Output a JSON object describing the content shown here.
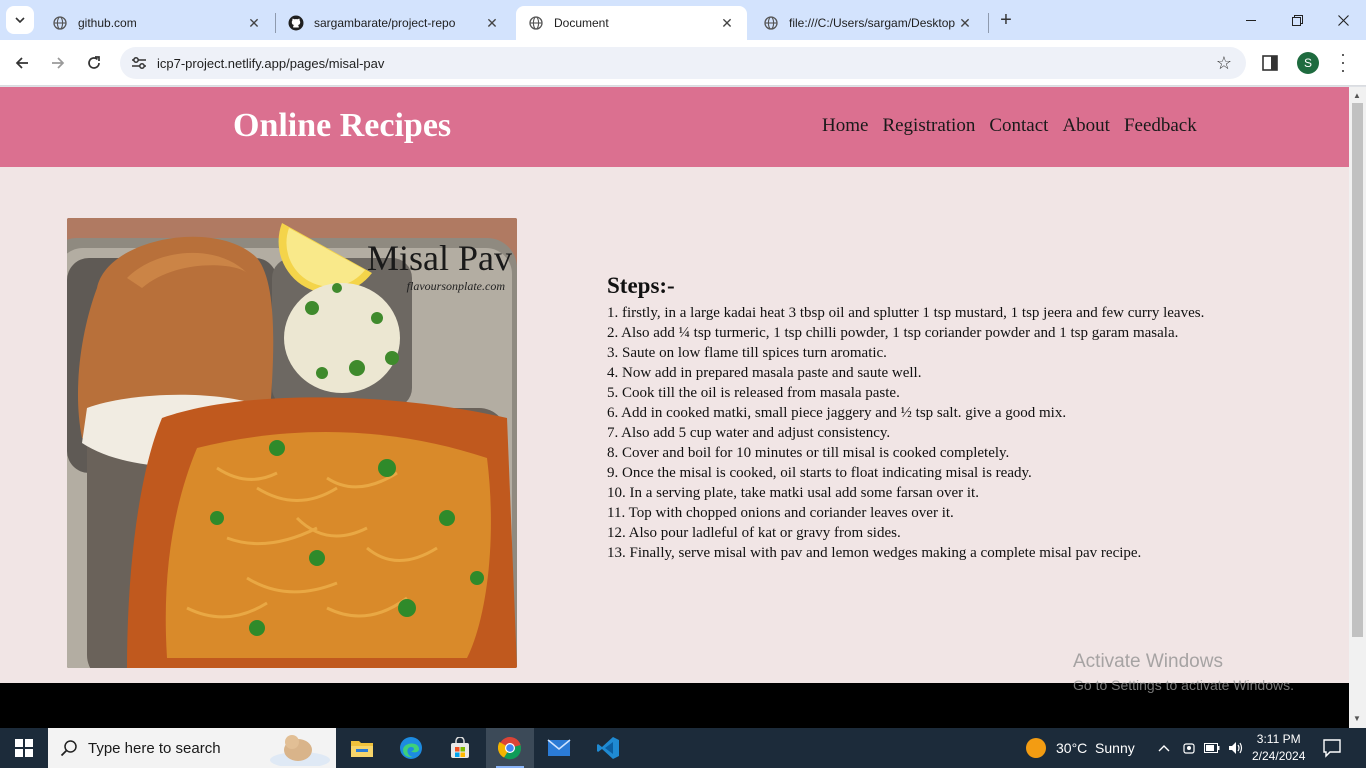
{
  "browser": {
    "tabs": [
      {
        "title": "github.com",
        "icon": "globe-icon",
        "active": false
      },
      {
        "title": "sargambarate/project-repo",
        "icon": "github-icon",
        "active": false
      },
      {
        "title": "Document",
        "icon": "globe-icon",
        "active": true
      },
      {
        "title": "file:///C:/Users/sargam/Desktop",
        "icon": "globe-icon",
        "active": false
      }
    ],
    "url": "icp7-project.netlify.app/pages/misal-pav",
    "profile_initial": "S"
  },
  "site": {
    "title": "Online Recipes",
    "nav": [
      "Home",
      "Registration",
      "Contact",
      "About",
      "Feedback"
    ],
    "header_color": "#db7090",
    "background_color": "#f1e5e5",
    "image": {
      "caption": "Misal Pav",
      "credit": "flavoursonplate.com"
    },
    "steps_heading": "Steps:-",
    "steps": [
      "1. firstly, in a large kadai heat 3 tbsp oil and splutter 1 tsp mustard, 1 tsp jeera and few curry leaves.",
      "2. Also add ¼ tsp turmeric, 1 tsp chilli powder, 1 tsp coriander powder and 1 tsp garam masala.",
      "3. Saute on low flame till spices turn aromatic.",
      "4. Now add in prepared masala paste and saute well.",
      "5. Cook till the oil is released from masala paste.",
      "6. Add in cooked matki, small piece jaggery and ½ tsp salt. give a good mix.",
      "7. Also add 5 cup water and adjust consistency.",
      "8. Cover and boil for 10 minutes or till misal is cooked completely.",
      "9. Once the misal is cooked, oil starts to float indicating misal is ready.",
      "10. In a serving plate, take matki usal add some farsan over it.",
      "11. Top with chopped onions and coriander leaves over it.",
      "12. Also pour ladleful of kat or gravy from sides.",
      "13. Finally, serve misal with pav and lemon wedges making a complete misal pav recipe."
    ]
  },
  "watermark": {
    "line1": "Activate Windows",
    "line2": "Go to Settings to activate Windows."
  },
  "taskbar": {
    "search_placeholder": "Type here to search",
    "apps": [
      "file-explorer-icon",
      "edge-icon",
      "store-icon",
      "chrome-icon",
      "mail-icon",
      "vscode-icon"
    ],
    "weather": "30°C  Sunny",
    "time": "3:11 PM",
    "date": "2/24/2024"
  }
}
